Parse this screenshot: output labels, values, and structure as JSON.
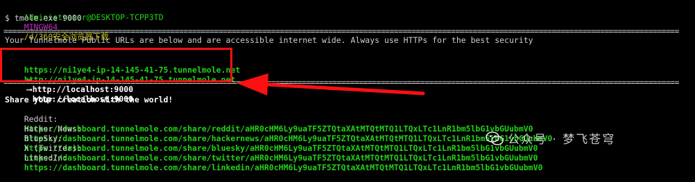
{
  "terminal": {
    "prompt": {
      "user_host": "Administrator@DESKTOP-TCPP3TD",
      "shell": "MINGW64",
      "path": "/d/360安全浏览器下载"
    },
    "command": "$ tmole.exe 9000",
    "separator": "==========================================================================================================================================================",
    "notice": "Your Tunnelmole Public URLs are below and are accessible internet wide. Always use HTTPs for the best security",
    "tunnels": [
      {
        "public_url": "https://ni1ye4-ip-14-145-41-75.tunnelmole.net",
        "arrow": "⟶",
        "local_url": "http://localhost:9000"
      },
      {
        "public_url": "http://ni1ye4-ip-14-145-41-75.tunnelmole.net",
        "arrow": "⟶",
        "local_url": "http://localhost:9000"
      }
    ],
    "share_heading": "Share your creation with the world!",
    "share_links": [
      {
        "label": "Reddit:",
        "url": "https://dashboard.tunnelmole.com/share/reddit/aHR0cHM6Ly9uaTF5ZTQtaXAtMTQtMTQ1LTQxLTc1LnR1bm5lbG1vbGUubmV0"
      },
      {
        "label": "Hacker News:",
        "url": "https://dashboard.tunnelmole.com/share/hackernews/aHR0cHM6Ly9uaTF5ZTQtaXAtMTQtMTQ1LTQxLTc1LnR1bm5lbG1vbGUubmV0"
      },
      {
        "label": "BlueSky:",
        "url": "https://dashboard.tunnelmole.com/share/bluesky/aHR0cHM6Ly9uaTF5ZTQtaXAtMTQtMTQ1LTQxLTc1LnR1bm5lbG1vbGUubmV0"
      },
      {
        "label": "X (Twitter):",
        "url": "https://dashboard.tunnelmole.com/share/twitter/aHR0cHM6Ly9uaTF5ZTQtaXAtMTQtMTQ1LTQxLTc1LnR1bm5lbG1vbGUubmV0"
      },
      {
        "label": "LinkedIn:",
        "url": "https://dashboard.tunnelmole.com/share/linkedin/aHR0cHM6Ly9uaTF5ZTQtaXAtMTQtMTQ1LTQxLTc1LnR1bm5lbG1vbGUubmV0"
      }
    ]
  },
  "annotation": {
    "box_color": "#ff1010",
    "arrow_color": "#ff1010"
  },
  "watermark": {
    "text": "公众号 · 梦飞苍穹"
  },
  "colors": {
    "green": "#23d11a",
    "magenta": "#c22fc4",
    "yellow": "#c6c31a",
    "background": "#000000"
  }
}
